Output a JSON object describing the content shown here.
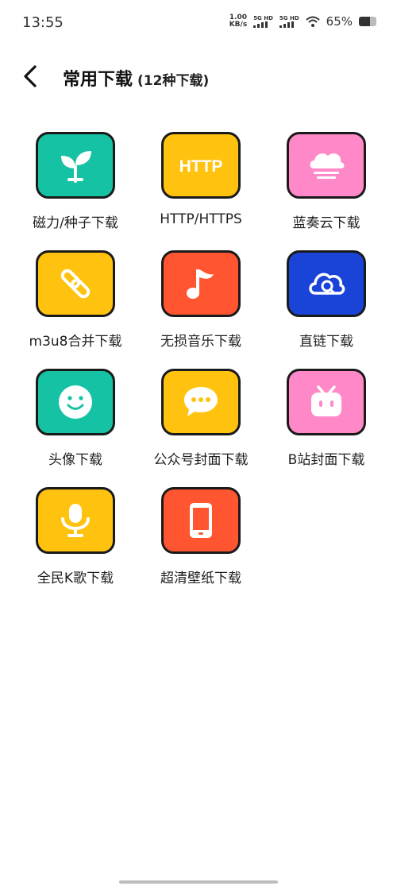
{
  "status_bar": {
    "time": "13:55",
    "net_speed_value": "1.00",
    "net_speed_unit": "KB/s",
    "sim1": "5G HD",
    "sim2": "5G HD",
    "battery_percent_text": "65%",
    "battery_level": 0.65
  },
  "header": {
    "title": "常用下载",
    "subtitle": "(12种下载)"
  },
  "tiles": [
    {
      "label": "磁力/种子下载",
      "icon": "sprout-icon",
      "color": "#16C2A4"
    },
    {
      "label": "HTTP/HTTPS",
      "icon": "http-icon",
      "icon_text": "HTTP",
      "color": "#FFC20E"
    },
    {
      "label": "蓝奏云下载",
      "icon": "cloud-icon",
      "color": "#FF88C8"
    },
    {
      "label": "m3u8合并下载",
      "icon": "link-icon",
      "color": "#FFC20E"
    },
    {
      "label": "无损音乐下载",
      "icon": "music-note-icon",
      "color": "#FF5530"
    },
    {
      "label": "直链下载",
      "icon": "cloud-search-icon",
      "color": "#1A44D8"
    },
    {
      "label": "头像下载",
      "icon": "smiley-icon",
      "color": "#16C2A4"
    },
    {
      "label": "公众号封面下载",
      "icon": "chat-bubble-icon",
      "color": "#FFC20E"
    },
    {
      "label": "B站封面下载",
      "icon": "bilibili-tv-icon",
      "color": "#FF88C8"
    },
    {
      "label": "全民K歌下载",
      "icon": "microphone-icon",
      "color": "#FFC20E"
    },
    {
      "label": "超清壁纸下载",
      "icon": "phone-icon",
      "color": "#FF5530"
    }
  ]
}
